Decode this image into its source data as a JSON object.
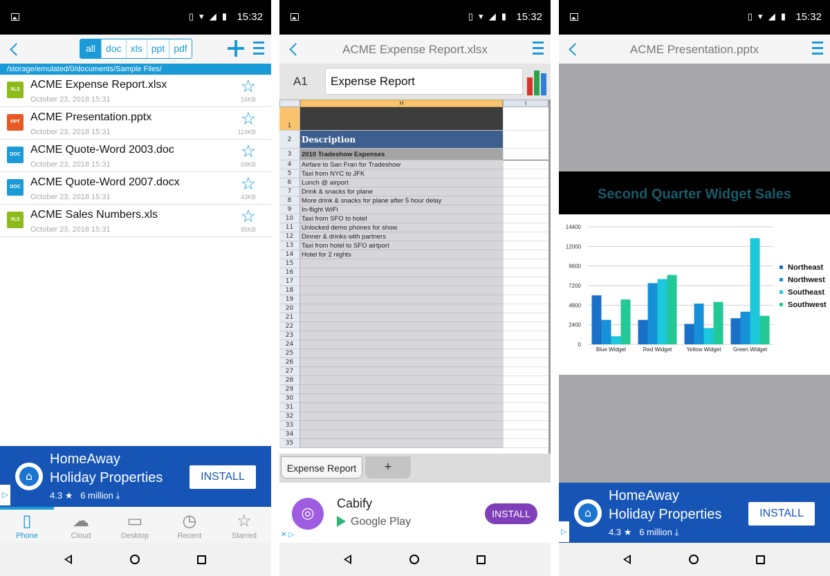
{
  "status": {
    "time": "15:32",
    "icons": "▯ ▾ ◢ ▮"
  },
  "screen1": {
    "filters": [
      "all",
      "doc",
      "xls",
      "ppt",
      "pdf"
    ],
    "path": "/storage/emulated/0/documents/Sample Files/",
    "files": [
      {
        "icon": "XLS",
        "color": "#8dbb1b",
        "name": "ACME Expense Report.xlsx",
        "date": "October 23, 2018 15:31",
        "size": "16KB"
      },
      {
        "icon": "PPT",
        "color": "#e75a23",
        "name": "ACME Presentation.pptx",
        "date": "October 23, 2018 15:31",
        "size": "119KB"
      },
      {
        "icon": "DOC",
        "color": "#1a9ad6",
        "name": "ACME Quote-Word 2003.doc",
        "date": "October 23, 2018 15:31",
        "size": "69KB"
      },
      {
        "icon": "DOC",
        "color": "#1a9ad6",
        "name": "ACME Quote-Word 2007.docx",
        "date": "October 23, 2018 15:31",
        "size": "43KB"
      },
      {
        "icon": "XLS",
        "color": "#8dbb1b",
        "name": "ACME Sales Numbers.xls",
        "date": "October 23, 2018 15:31",
        "size": "85KB"
      }
    ],
    "ad": {
      "line1": "HomeAway",
      "line2": "Holiday Properties",
      "rating": "4.3",
      "downloads": "6 million",
      "install": "INSTALL"
    },
    "tabs": [
      {
        "label": "Phone",
        "icon": "▯"
      },
      {
        "label": "Cloud",
        "icon": "☁"
      },
      {
        "label": "Desktop",
        "icon": "▭"
      },
      {
        "label": "Recent",
        "icon": "◷"
      },
      {
        "label": "Starred",
        "icon": "☆"
      }
    ]
  },
  "screen2": {
    "title": "ACME Expense Report.xlsx",
    "cell_ref": "A1",
    "formula": "Expense Report",
    "col_h": "H",
    "col_i": "I",
    "rows": [
      {
        "num": "1",
        "text": ""
      },
      {
        "num": "2",
        "text": "Description"
      },
      {
        "num": "3",
        "text": "2010 Tradeshow Expenses"
      },
      {
        "num": "4",
        "text": "Airfare to San Fran for Tradeshow"
      },
      {
        "num": "5",
        "text": "Taxi from NYC to JFK"
      },
      {
        "num": "6",
        "text": "Lunch @ airport"
      },
      {
        "num": "7",
        "text": "Drink & snacks for plane"
      },
      {
        "num": "8",
        "text": "More drink & snacks for plane after 5 hour delay"
      },
      {
        "num": "9",
        "text": "In-flight WiFi"
      },
      {
        "num": "10",
        "text": "Taxi from SFO to hotel"
      },
      {
        "num": "11",
        "text": "Unlocked demo phones for show"
      },
      {
        "num": "12",
        "text": "Dinner & drinks with partners"
      },
      {
        "num": "13",
        "text": "Taxi from hotel to SFO airtport"
      },
      {
        "num": "14",
        "text": "Hotel for 2 nights"
      },
      {
        "num": "15",
        "text": ""
      },
      {
        "num": "16",
        "text": ""
      },
      {
        "num": "17",
        "text": ""
      },
      {
        "num": "18",
        "text": ""
      },
      {
        "num": "19",
        "text": ""
      },
      {
        "num": "20",
        "text": ""
      },
      {
        "num": "21",
        "text": ""
      },
      {
        "num": "22",
        "text": ""
      },
      {
        "num": "23",
        "text": ""
      },
      {
        "num": "24",
        "text": ""
      },
      {
        "num": "25",
        "text": ""
      },
      {
        "num": "26",
        "text": ""
      },
      {
        "num": "27",
        "text": ""
      },
      {
        "num": "28",
        "text": ""
      },
      {
        "num": "29",
        "text": ""
      },
      {
        "num": "30",
        "text": ""
      },
      {
        "num": "31",
        "text": ""
      },
      {
        "num": "32",
        "text": ""
      },
      {
        "num": "33",
        "text": ""
      },
      {
        "num": "34",
        "text": ""
      },
      {
        "num": "35",
        "text": ""
      }
    ],
    "sheet_tab": "Expense Report",
    "add_sheet": "+",
    "ad": {
      "name": "Cabify",
      "store": "Google Play",
      "install": "INSTALL"
    }
  },
  "screen3": {
    "title": "ACME Presentation.pptx",
    "slide_title": "Second Quarter Widget Sales",
    "ad": {
      "line1": "HomeAway",
      "line2": "Holiday Properties",
      "rating": "4.3",
      "downloads": "6 million",
      "install": "INSTALL"
    }
  },
  "chart_data": {
    "type": "bar",
    "categories": [
      "Blue Widget",
      "Red Widget",
      "Yellow Widget",
      "Green Widget"
    ],
    "series": [
      {
        "name": "Northeast",
        "color": "#1a6fc6",
        "values": [
          6000,
          3000,
          2500,
          3200
        ]
      },
      {
        "name": "Northwest",
        "color": "#1690d6",
        "values": [
          3000,
          7500,
          5000,
          4000
        ]
      },
      {
        "name": "Southeast",
        "color": "#1ec8dc",
        "values": [
          1000,
          8000,
          2000,
          13000
        ]
      },
      {
        "name": "Southwest",
        "color": "#22c896",
        "values": [
          5500,
          8500,
          5200,
          3500
        ]
      }
    ],
    "y_ticks": [
      "0",
      "2400",
      "4800",
      "7200",
      "9600",
      "12000",
      "14400"
    ],
    "ylim": [
      0,
      14400
    ],
    "legend": "right",
    "grid": true
  }
}
